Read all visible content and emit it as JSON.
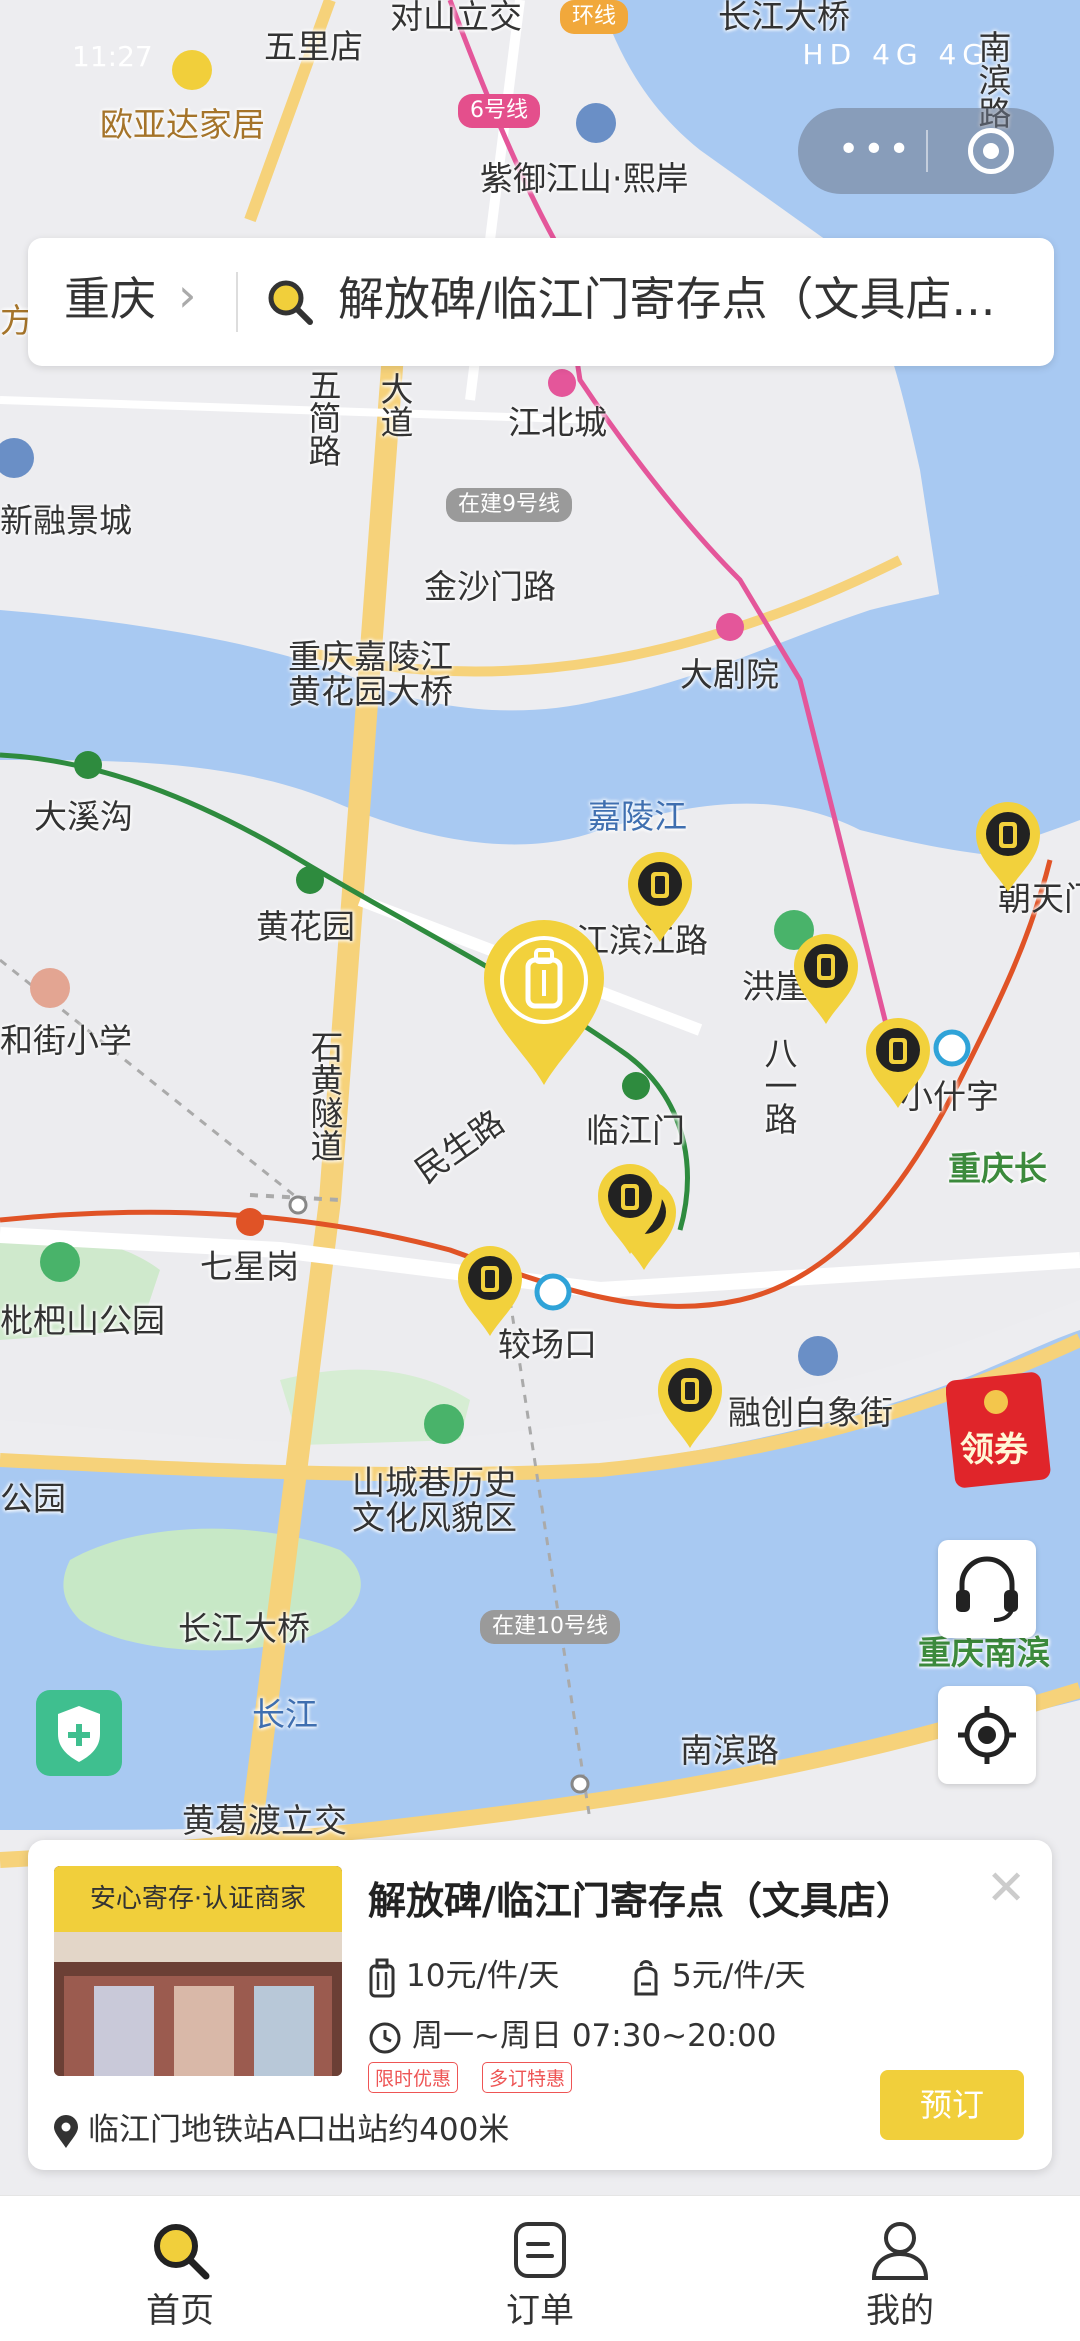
{
  "status_bar": {
    "time": "11:27",
    "signal": "HD 4G 4G"
  },
  "search": {
    "city": "重庆",
    "query": "解放碑/临江门寄存点（文具店..."
  },
  "map": {
    "labels": {
      "wulidian": "五里店",
      "duishanlijiao": "对山立交",
      "changjiangdaqiao_top": "长江大桥",
      "huanxian": "环线",
      "nanbinlu_top": "南滨路",
      "ouyada": "欧亚达家居",
      "line6": "6号线",
      "ziyu": "紫御江山·熙岸",
      "fang": "方",
      "jiangbeicheng": "江北城",
      "dadao": "大道",
      "wutong": "五简路",
      "rongjing": "新融景城",
      "line9": "在建9号线",
      "jinshamen": "金沙门路",
      "dajuyuan": "大剧院",
      "jialing_bridge": "重庆嘉陵江\n黄花园大桥",
      "daxigou": "大溪沟",
      "jialingjiang": "嘉陵江",
      "huanghuayuan": "黄花园",
      "binjianglu": "江滨江路",
      "hongya": "洪崖",
      "chaotianmen": "朝天门",
      "hejie": "和街小学",
      "shihuangsuidao": "石黄隧道",
      "minshenglu": "民生路",
      "linjiangmen": "临江门",
      "bayilu": "八一路",
      "xiaoshizi": "小什字",
      "chongqingchang": "重庆长",
      "qixinggang": "七星岗",
      "pipashan": "枇杷山公园",
      "jiaochangkou": "较场口",
      "rongchuang": "融创白象街",
      "shancheng": "山城巷历史\n文化风貌区",
      "gongyuan": "公园",
      "changjiangdaqiao": "长江大桥",
      "line10": "在建10号线",
      "changjiang": "长江",
      "nanbinlu": "南滨路",
      "huangge": "黄葛渡立交",
      "chongqingnanbin": "重庆南滨"
    }
  },
  "hongbao": {
    "label": "领券"
  },
  "card": {
    "badge": "安心寄存·认证商家",
    "title": "解放碑/临江门寄存点（文具店）",
    "price_large": "10元/件/天",
    "price_small": "5元/件/天",
    "hours": "周一~周日 07:30~20:00",
    "tags": [
      "限时优惠",
      "多订特惠"
    ],
    "address": "临江门地铁站A口出站约400米",
    "book_label": "预订"
  },
  "tabs": [
    {
      "label": "首页",
      "icon": "search-icon"
    },
    {
      "label": "订单",
      "icon": "order-icon"
    },
    {
      "label": "我的",
      "icon": "user-icon"
    }
  ],
  "colors": {
    "accent": "#f1cf3b",
    "water": "#a8c9f2",
    "land": "#eeeeee",
    "road": "#f6d27a",
    "pink_line": "#e4569a",
    "green_line": "#2e8b3e",
    "red_line": "#e05326"
  }
}
